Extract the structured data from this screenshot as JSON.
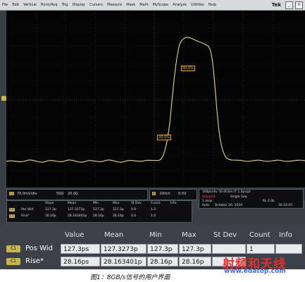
{
  "menubar": {
    "items": [
      "File",
      "Edit",
      "Vertical",
      "Horiz/Acq",
      "Trig",
      "Display",
      "Cursors",
      "Measure",
      "Mask",
      "Math",
      "MyScope",
      "Analyze",
      "Utilities",
      "Help"
    ],
    "brand": "Tek",
    "window_buttons": [
      "_",
      "×"
    ]
  },
  "markers": {
    "top": "80.0%",
    "bottom": "20.0%"
  },
  "channel_readout": {
    "tag": "C1",
    "scale": "70.0mV/div",
    "impedance": "50Ω",
    "bandwidth": "20.0G"
  },
  "trigger_readout": {
    "tag": "B",
    "type": "Glitch",
    "level": "0.0V"
  },
  "time_readout": {
    "line1": "100ps/div  50.0GS/s  IT  1.0ps/pt",
    "stopped": "Stopped",
    "mode": "Single Seq",
    "acqs": "1 acqs",
    "rl": "RL:1.0k",
    "auto": "Auto",
    "date": "October 26, 2010",
    "time": "16:33:45"
  },
  "small_table": {
    "headers": [
      "Value",
      "Mean",
      "Min",
      "Max",
      "St Dev",
      "Count",
      "Info"
    ],
    "rows": [
      {
        "tag": "C1",
        "label": "Pos Wid",
        "cells": [
          "127.3p",
          "127.3273p",
          "127.3p",
          "127.3p",
          "0.0",
          "1.0",
          ""
        ]
      },
      {
        "tag": "C1",
        "label": "Rise*",
        "cells": [
          "28.16p",
          "28.163401p",
          "28.16p",
          "28.16p",
          "0.0",
          "1.0",
          ""
        ]
      }
    ]
  },
  "big_table": {
    "headers": [
      "Value",
      "Mean",
      "Min",
      "Max",
      "St Dev",
      "Count",
      "Info"
    ],
    "rows": [
      {
        "tag": "C1",
        "label": "Pos Wid",
        "cells": [
          "127.3ps",
          "127.3273p",
          "127.3p",
          "127.3p",
          "",
          "1",
          ""
        ]
      },
      {
        "tag": "C1",
        "label": "Rise*",
        "cells": [
          "28.16ps",
          "28.163401p",
          "28.16p",
          "28.16p",
          "",
          "",
          ""
        ]
      }
    ]
  },
  "watermark": {
    "text": "射频和天线",
    "url": "www.edatop.com"
  },
  "caption": "图1：8GB/s信号的用户界面"
}
